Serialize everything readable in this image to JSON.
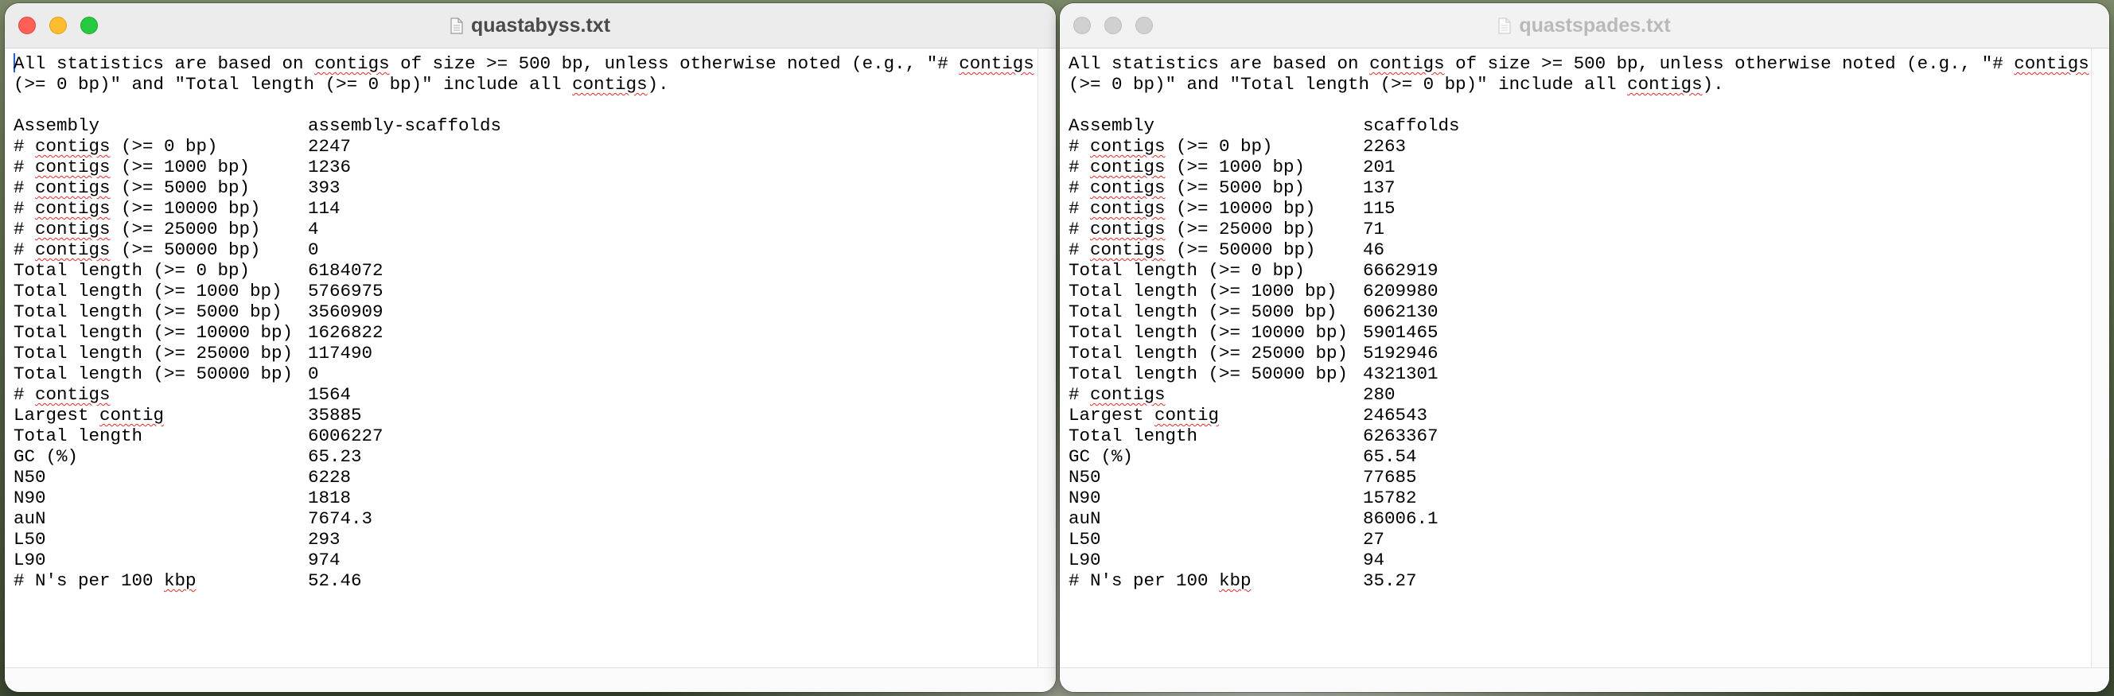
{
  "left_window": {
    "title": "quastabyss.txt",
    "intro_lines": [
      "All statistics are based on contigs of size >= 500 bp, unless otherwise noted (e.g., \"# contigs",
      "(>= 0 bp)\" and \"Total length (>= 0 bp)\" include all contigs)."
    ],
    "rows": [
      {
        "label": "Assembly",
        "value": "assembly-scaffolds"
      },
      {
        "label": "# contigs (>= 0 bp)",
        "value": "2247"
      },
      {
        "label": "# contigs (>= 1000 bp)",
        "value": "1236"
      },
      {
        "label": "# contigs (>= 5000 bp)",
        "value": "393"
      },
      {
        "label": "# contigs (>= 10000 bp)",
        "value": "114"
      },
      {
        "label": "# contigs (>= 25000 bp)",
        "value": "4"
      },
      {
        "label": "# contigs (>= 50000 bp)",
        "value": "0"
      },
      {
        "label": "Total length (>= 0 bp)",
        "value": "6184072"
      },
      {
        "label": "Total length (>= 1000 bp)",
        "value": "5766975"
      },
      {
        "label": "Total length (>= 5000 bp)",
        "value": "3560909"
      },
      {
        "label": "Total length (>= 10000 bp)",
        "value": "1626822"
      },
      {
        "label": "Total length (>= 25000 bp)",
        "value": "117490"
      },
      {
        "label": "Total length (>= 50000 bp)",
        "value": "0"
      },
      {
        "label": "# contigs",
        "value": "1564"
      },
      {
        "label": "Largest contig",
        "value": "35885"
      },
      {
        "label": "Total length",
        "value": "6006227"
      },
      {
        "label": "GC (%)",
        "value": "65.23"
      },
      {
        "label": "N50",
        "value": "6228"
      },
      {
        "label": "N90",
        "value": "1818"
      },
      {
        "label": "auN",
        "value": "7674.3"
      },
      {
        "label": "L50",
        "value": "293"
      },
      {
        "label": "L90",
        "value": "974"
      },
      {
        "label": "# N's per 100 kbp",
        "value": "52.46"
      }
    ]
  },
  "right_window": {
    "title": "quastspades.txt",
    "intro_lines": [
      "All statistics are based on contigs of size >= 500 bp, unless otherwise noted (e.g., \"# contigs",
      "(>= 0 bp)\" and \"Total length (>= 0 bp)\" include all contigs)."
    ],
    "rows": [
      {
        "label": "Assembly",
        "value": "scaffolds"
      },
      {
        "label": "# contigs (>= 0 bp)",
        "value": "2263"
      },
      {
        "label": "# contigs (>= 1000 bp)",
        "value": "201"
      },
      {
        "label": "# contigs (>= 5000 bp)",
        "value": "137"
      },
      {
        "label": "# contigs (>= 10000 bp)",
        "value": "115"
      },
      {
        "label": "# contigs (>= 25000 bp)",
        "value": "71"
      },
      {
        "label": "# contigs (>= 50000 bp)",
        "value": "46"
      },
      {
        "label": "Total length (>= 0 bp)",
        "value": "6662919"
      },
      {
        "label": "Total length (>= 1000 bp)",
        "value": "6209980"
      },
      {
        "label": "Total length (>= 5000 bp)",
        "value": "6062130"
      },
      {
        "label": "Total length (>= 10000 bp)",
        "value": "5901465"
      },
      {
        "label": "Total length (>= 25000 bp)",
        "value": "5192946"
      },
      {
        "label": "Total length (>= 50000 bp)",
        "value": "4321301"
      },
      {
        "label": "# contigs",
        "value": "280"
      },
      {
        "label": "Largest contig",
        "value": "246543"
      },
      {
        "label": "Total length",
        "value": "6263367"
      },
      {
        "label": "GC (%)",
        "value": "65.54"
      },
      {
        "label": "N50",
        "value": "77685"
      },
      {
        "label": "N90",
        "value": "15782"
      },
      {
        "label": "auN",
        "value": "86006.1"
      },
      {
        "label": "L50",
        "value": "27"
      },
      {
        "label": "L90",
        "value": "94"
      },
      {
        "label": "# N's per 100 kbp",
        "value": "35.27"
      }
    ]
  },
  "colors": {
    "close": "#fe5f57",
    "minimize": "#febc2e",
    "zoom": "#28c840",
    "spellcheck": "#e0302e",
    "caret": "#1a5cff"
  },
  "icons": {
    "document": "doc-icon",
    "close": "close-icon",
    "minimize": "minimize-icon",
    "zoom": "zoom-icon"
  }
}
